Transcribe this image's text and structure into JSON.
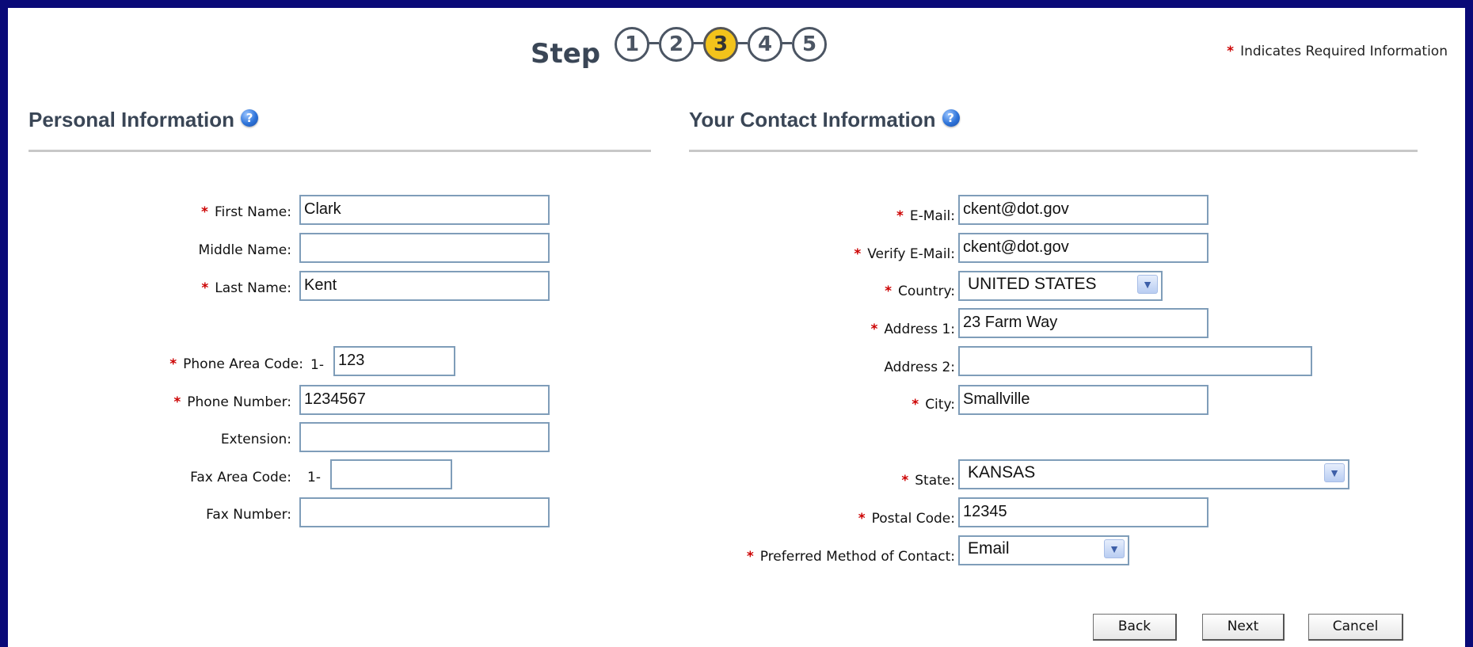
{
  "header": {
    "step_word": "Step",
    "steps": [
      "1",
      "2",
      "3",
      "4",
      "5"
    ],
    "current_step": "3",
    "required_note": "Indicates Required Information"
  },
  "personal": {
    "title": "Personal Information",
    "first_name": {
      "label": "First Name:",
      "value": "Clark",
      "required": true
    },
    "middle_name": {
      "label": "Middle Name:",
      "value": "",
      "required": false
    },
    "last_name": {
      "label": "Last Name:",
      "value": "Kent",
      "required": true
    },
    "phone_area": {
      "label": "Phone Area Code:",
      "prefix": "1-",
      "value": "123",
      "required": true
    },
    "phone_number": {
      "label": "Phone Number:",
      "value": "1234567",
      "required": true
    },
    "extension": {
      "label": "Extension:",
      "value": "",
      "required": false
    },
    "fax_area": {
      "label": "Fax Area Code:",
      "prefix": "1-",
      "value": "",
      "required": false
    },
    "fax_number": {
      "label": "Fax Number:",
      "value": "",
      "required": false
    }
  },
  "contact": {
    "title": "Your Contact Information",
    "email": {
      "label": "E-Mail:",
      "value": "ckent@dot.gov",
      "required": true
    },
    "verify_email": {
      "label": "Verify E-Mail:",
      "value": "ckent@dot.gov",
      "required": true
    },
    "country": {
      "label": "Country:",
      "value": "UNITED STATES",
      "required": true
    },
    "address1": {
      "label": "Address 1:",
      "value": "23 Farm Way",
      "required": true
    },
    "address2": {
      "label": "Address 2:",
      "value": "",
      "required": false
    },
    "city": {
      "label": "City:",
      "value": "Smallville",
      "required": true
    },
    "state": {
      "label": "State:",
      "value": "KANSAS",
      "required": true
    },
    "postal_code": {
      "label": "Postal Code:",
      "value": "12345",
      "required": true
    },
    "preferred_contact": {
      "label": "Preferred Method of Contact:",
      "value": "Email",
      "required": true
    }
  },
  "buttons": {
    "back": "Back",
    "next": "Next",
    "cancel": "Cancel"
  },
  "colors": {
    "frame": "#0a0a78",
    "required_star": "#cc0000",
    "active_step": "#f3c31b",
    "field_border": "#7f9db9"
  },
  "icons": {
    "help": "help-question-icon",
    "dropdown": "chevron-down-icon"
  }
}
